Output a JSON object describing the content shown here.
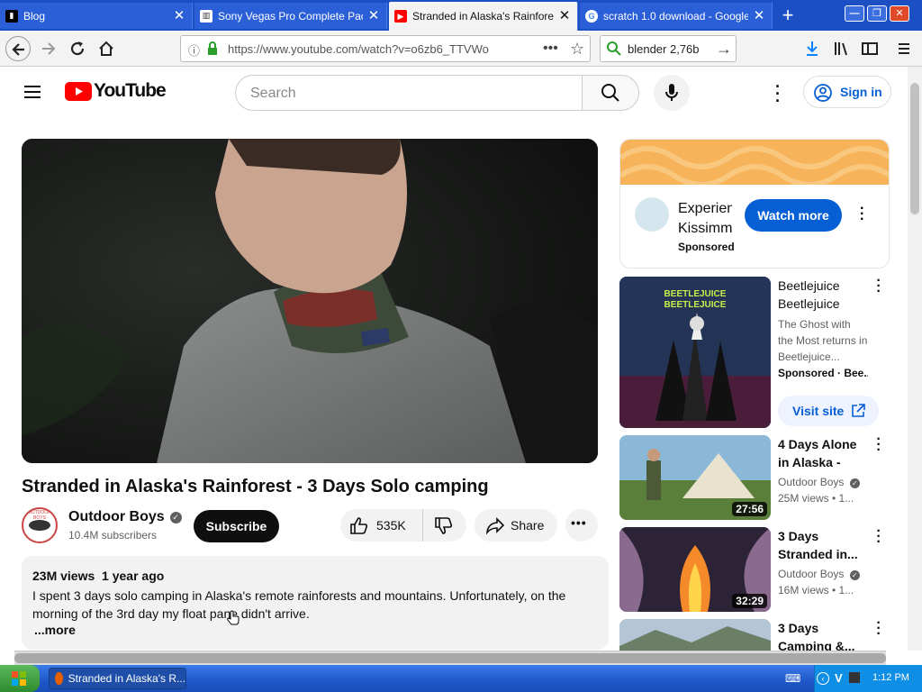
{
  "browser": {
    "tabs": [
      {
        "title": "Blog",
        "favicon": "blog-icon"
      },
      {
        "title": "Sony Vegas Pro Complete Pack",
        "favicon": "archive-icon"
      },
      {
        "title": "Stranded in Alaska's Rainforest",
        "favicon": "youtube-icon",
        "active": true
      },
      {
        "title": "scratch 1.0 download - Google",
        "favicon": "google-icon"
      }
    ],
    "url": "https://www.youtube.com/watch?v=o6zb6_TTVWo",
    "search_value": "blender 2,76b"
  },
  "youtube": {
    "logo_text": "YouTube",
    "search_placeholder": "Search",
    "signin_label": "Sign in",
    "video": {
      "title": "Stranded in Alaska's Rainforest - 3 Days Solo camping",
      "channel": "Outdoor Boys",
      "subscribers": "10.4M subscribers",
      "subscribe_label": "Subscribe",
      "likes": "535K",
      "share_label": "Share",
      "views": "23M views",
      "age": "1 year ago",
      "description": "I spent 3 days solo camping in Alaska's remote rainforests and mountains. Unfortunately, on the morning of the 3rd day my float pane didn't arrive.",
      "more_label": "...more",
      "avatar_text": "OUTDOOR BOYS"
    },
    "ad": {
      "title": "Experien Kissimm",
      "sponsored": "Sponsored",
      "button": "Watch more"
    },
    "sidebar": [
      {
        "title": "Beetlejuice Beetlejuice",
        "line2": "The Ghost with the Most returns in Beetlejuice...",
        "line3": "Sponsored · Bee...",
        "visit": "Visit site",
        "thumb_text": "BEETLEJUICE BEETLEJUICE"
      },
      {
        "title": "4 Days Alone in Alaska -",
        "channel": "Outdoor Boys",
        "stats": "25M views • 1...",
        "duration": "27:56"
      },
      {
        "title": "3 Days Stranded in...",
        "channel": "Outdoor Boys",
        "stats": "16M views • 1...",
        "duration": "32:29"
      },
      {
        "title": "3 Days Camping &..."
      }
    ]
  },
  "taskbar": {
    "task_label": "Stranded in Alaska's R...",
    "clock": "1:12 PM"
  },
  "colors": {
    "youtube_red": "#ff0000",
    "link_blue": "#065fd4",
    "ad_button_blue": "#065fd4",
    "taskbar_blue": "#1f57c8"
  }
}
